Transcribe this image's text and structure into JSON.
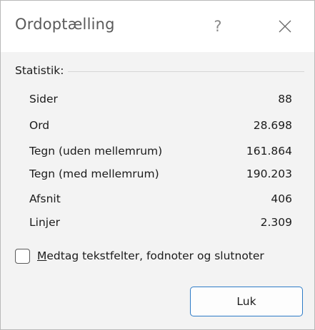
{
  "dialog": {
    "title": "Ordoptælling",
    "help_glyph": "?",
    "close_icon": "close-icon"
  },
  "statistics": {
    "header": "Statistik:",
    "rows": [
      {
        "label": "Sider",
        "value": "88"
      },
      {
        "label": "Ord",
        "value": "28.698"
      },
      {
        "label": "Tegn (uden mellemrum)",
        "value": "161.864"
      },
      {
        "label": "Tegn (med mellemrum)",
        "value": "190.203"
      },
      {
        "label": "Afsnit",
        "value": "406"
      },
      {
        "label": "Linjer",
        "value": "2.309"
      }
    ]
  },
  "options": {
    "include_label_accel": "M",
    "include_label_rest": "edtag tekstfelter, fodnoter og slutnoter",
    "include_checked": false
  },
  "buttons": {
    "close_label": "Luk"
  },
  "colors": {
    "dialog_background": "#f3f3f3",
    "titlebar_background": "#ffffff",
    "default_button_border": "#2d7bc7"
  }
}
